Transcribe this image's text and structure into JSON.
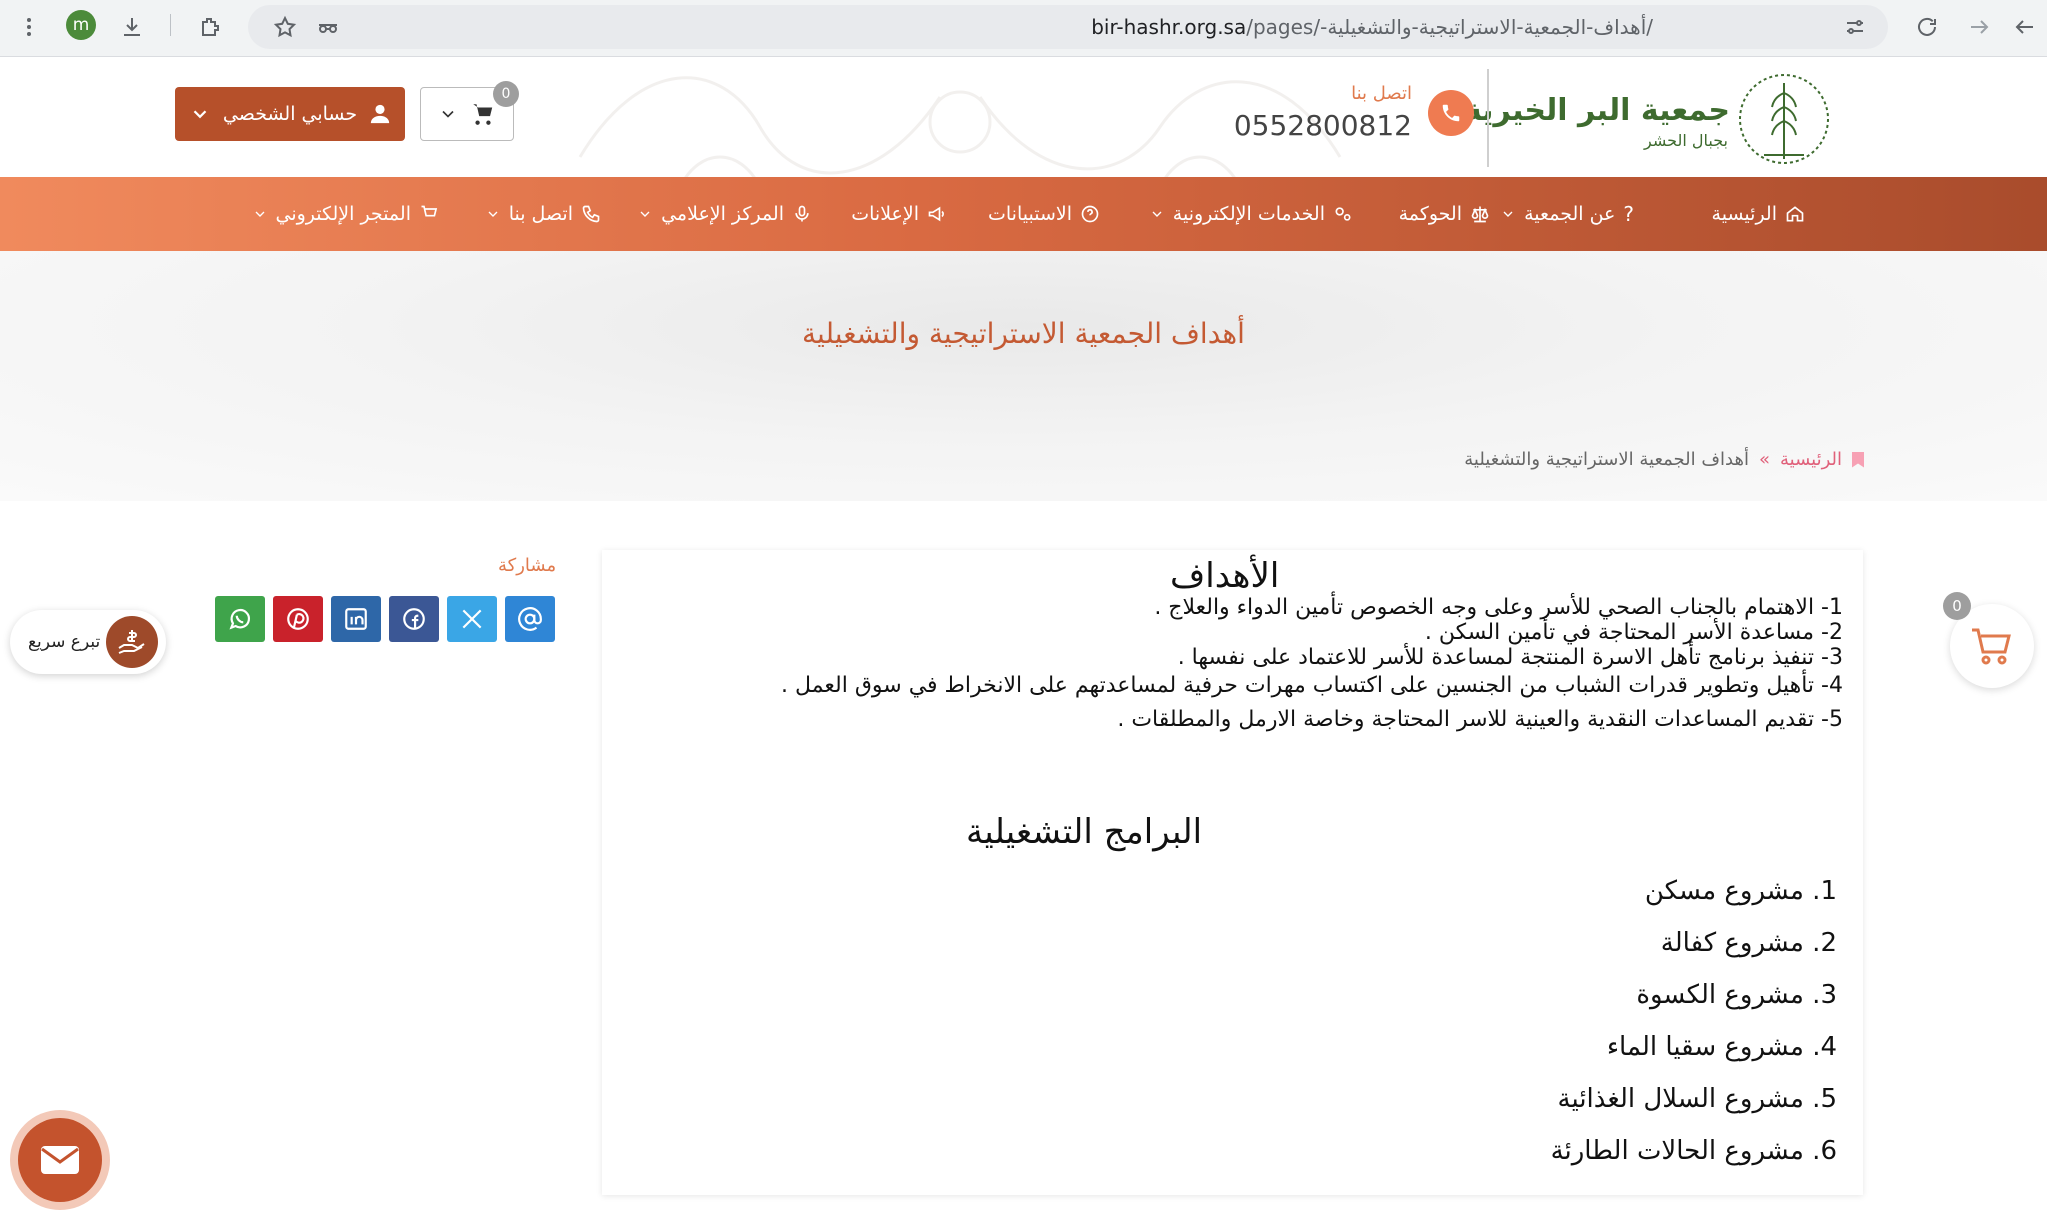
{
  "browser": {
    "url_host": "bir-hashr.org.sa",
    "url_path": "/pages/-أهداف-الجمعية-الاستراتيجية-والتشغيلية/",
    "profile_initial": "m"
  },
  "header": {
    "logo_title": "جمعية البر الخيرية",
    "logo_subtitle": "بجبال الحشر",
    "contact_label": "اتصل بنا",
    "phone": "0552800812",
    "account_label": "حسابي الشخصي",
    "cart_count": "0"
  },
  "nav": {
    "items": [
      {
        "label": "الرئيسية",
        "icon": "home-icon"
      },
      {
        "label": "عن الجمعية",
        "icon": "question-icon"
      },
      {
        "label": "الحوكمة",
        "icon": "scale-icon"
      },
      {
        "label": "الخدمات الإلكترونية",
        "icon": "gears-icon"
      },
      {
        "label": "الاستبيانات",
        "icon": "question-circle-icon"
      },
      {
        "label": "الإعلانات",
        "icon": "megaphone-icon"
      },
      {
        "label": "المركز الإعلامي",
        "icon": "microphone-icon"
      },
      {
        "label": "اتصل بنا",
        "icon": "phone-icon"
      },
      {
        "label": "المتجر الإلكتروني",
        "icon": "cart-icon"
      }
    ]
  },
  "hero": {
    "title": "أهداف الجمعية الاستراتيجية والتشغيلية",
    "breadcrumb_home": "الرئيسية",
    "breadcrumb_sep": "»",
    "breadcrumb_current": "أهداف الجمعية الاستراتيجية والتشغيلية"
  },
  "share": {
    "label": "مشاركة"
  },
  "content": {
    "goals_heading": "الأهداف",
    "goals": [
      "1- الاهتمام بالجناب الصحي للأسر وعلى وجه الخصوص تأمين الدواء والعلاج .",
      "2- مساعدة الأسر المحتاجة في تأمين السكن .",
      "3- تنفيذ برنامج تأهل الاسرة المنتجة لمساعدة للأسر للاعتماد على نفسها .",
      "4- تأهيل وتطوير قدرات الشباب من الجنسين على اكتساب مهرات حرفية لمساعدتهم على الانخراط في سوق العمل .",
      "5- تقديم المساعدات النقدية والعينية للاسر المحتاجة وخاصة الارمل والمطلقات ."
    ],
    "programs_heading": "البرامج التشغيلية",
    "programs": [
      "1. مشروع مسكن",
      "2. مشروع كفالة",
      "3. مشروع الكسوة",
      "4. مشروع سقيا الماء",
      "5. مشروع السلال الغذائية",
      "6. مشروع الحالات الطارئة"
    ]
  },
  "floating": {
    "quick_donate_label": "تبرع سريع",
    "cart_count": "0"
  },
  "colors": {
    "accent": "#c45a33",
    "nav_start": "#f08a5d",
    "nav_end": "#a94c2c",
    "brand_green": "#3e6b2f"
  }
}
